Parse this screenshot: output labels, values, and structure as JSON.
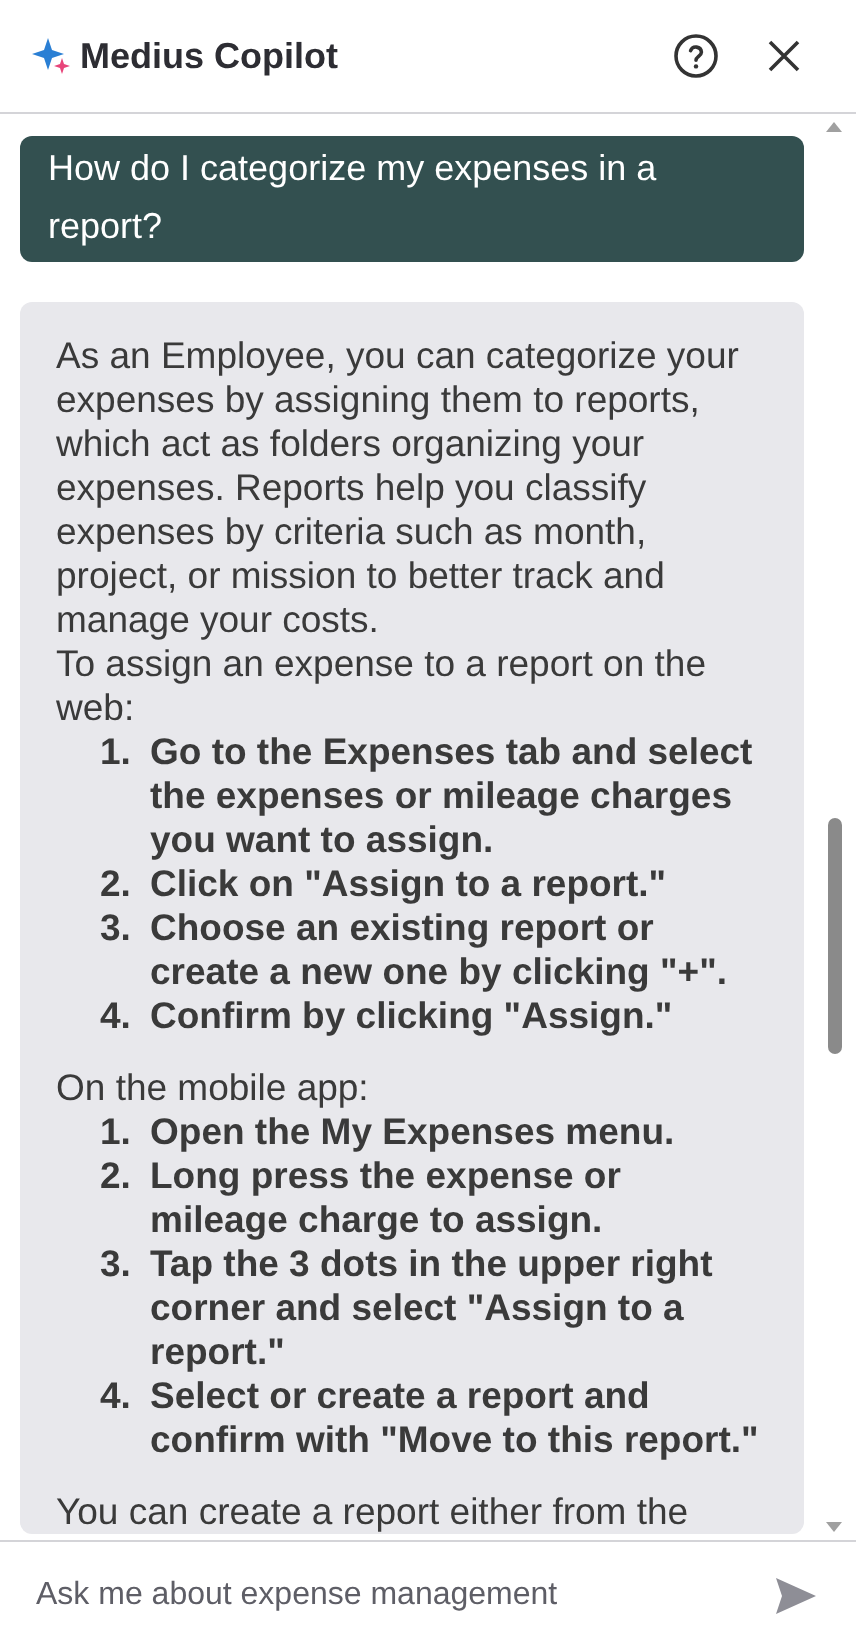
{
  "header": {
    "title": "Medius Copilot"
  },
  "messages": [
    {
      "kind": "question",
      "text": "How do I categorize my expenses in a report?"
    },
    {
      "kind": "answer",
      "blocks": [
        {
          "kind": "paragraph",
          "text": "As an Employee, you can categorize your expenses by assigning them to reports, which act as folders organizing your expenses. Reports help you classify expenses by criteria such as month, project, or mission to better track and manage your costs."
        },
        {
          "kind": "paragraph",
          "text": "To assign an expense to a report on the web:"
        },
        {
          "kind": "list",
          "items": [
            {
              "marker": "1.",
              "text": "Go to the Expenses tab and select the expenses or mileage charges you want to assign."
            },
            {
              "marker": "2.",
              "text": "Click on \"Assign to a report.\""
            },
            {
              "marker": "3.",
              "text": "Choose an existing report or create a new one by clicking \"+\"."
            },
            {
              "marker": "4.",
              "text": "Confirm by clicking \"Assign.\""
            }
          ]
        },
        {
          "kind": "paragraph",
          "text": "On the mobile app:"
        },
        {
          "kind": "list",
          "items": [
            {
              "marker": "1.",
              "text": "Open the My Expenses menu."
            },
            {
              "marker": "2.",
              "text": "Long press the expense or mileage charge to assign."
            },
            {
              "marker": "3.",
              "text": "Tap the 3 dots in the upper right corner and select \"Assign to a report.\""
            },
            {
              "marker": "4.",
              "text": "Select or create a report and confirm with \"Move to this report.\""
            }
          ]
        },
        {
          "kind": "paragraph",
          "text": "You can create a report either from the"
        }
      ]
    }
  ],
  "composer": {
    "placeholder": "Ask me about expense management"
  }
}
